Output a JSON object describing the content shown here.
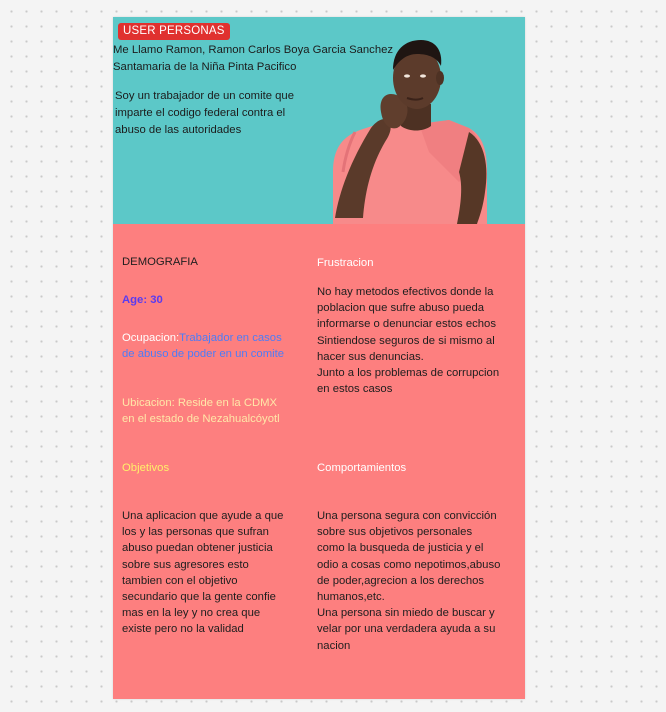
{
  "badge": "USER PERSONAS",
  "header": {
    "name_line1": "Me Llamo Ramon, Ramon Carlos Boya Garcia Sanchez",
    "name_line2": "Santamaria de la Niña Pinta Pacifico",
    "bio_line1": "Soy un trabajador de un comite que",
    "bio_line2": "imparte el codigo federal contra el",
    "bio_line3": "abuso de las autoridades"
  },
  "demografia": {
    "title": "DEMOGRAFIA",
    "age": "Age: 30",
    "ocupacion_label": "Ocupacion:",
    "ocupacion_value_line1": "Trabajador en casos",
    "ocupacion_value_line2": "de abuso de poder en un comite",
    "ubicacion_line1": "Ubicacion: Reside en la CDMX",
    "ubicacion_line2": "en el estado de Nezahualcóyotl"
  },
  "frustracion": {
    "title": "Frustracion",
    "lines": [
      "No hay metodos efectivos donde la",
      "poblacion que sufre abuso pueda",
      "informarse o denunciar estos echos",
      "Sintiendose seguros de si mismo al",
      "hacer sus denuncias.",
      "Junto a los problemas de corrupcion",
      "en estos casos"
    ]
  },
  "objetivos": {
    "title": "Objetivos",
    "lines": [
      "Una aplicacion que ayude a que",
      "los y las personas que sufran",
      "abuso puedan obtener justicia",
      "sobre sus agresores esto",
      "tambien con el objetivo",
      "secundario que la gente confie",
      "mas en la ley y no crea que",
      "existe pero no la validad"
    ]
  },
  "comportamientos": {
    "title": "Comportamientos",
    "lines": [
      "Una persona segura con convicción",
      "sobre sus objetivos personales",
      "como la busqueda de justicia y el",
      "odio a cosas como nepotimos,abuso",
      "de poder,agrecion a los derechos",
      "humanos,etc.",
      "Una persona sin miedo de buscar y",
      "velar por una verdadera ayuda a su",
      "nacion"
    ]
  },
  "colors": {
    "header_bg": "#5cc8c8",
    "body_bg": "#fd7f7f",
    "badge_bg": "#e0312f",
    "shirt": "#f78a8a",
    "skin": "#5a3a2a"
  },
  "image": {
    "subject": "thinking-man-photo"
  }
}
